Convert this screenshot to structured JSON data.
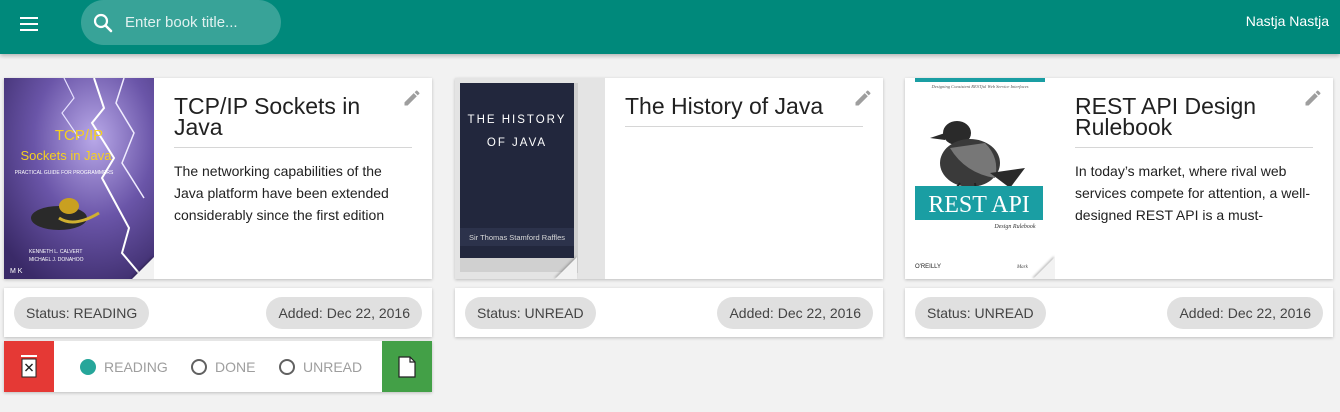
{
  "header": {
    "search_placeholder": "Enter book title...",
    "user_name": "Nastja Nastja",
    "accent_color": "#00897b"
  },
  "books": [
    {
      "title": "TCP/IP Sockets in Java",
      "description": "The networking capabilities of the Java platform have been extended considerably since the first edition",
      "status": "Status: READING",
      "added": "Added: Dec 22, 2016",
      "cover": {
        "title": "TCP/IP Sockets in Java",
        "subtitle": "PRACTICAL GUIDE FOR PROGRAMMERS",
        "authors": [
          "KENNETH L. CALVERT",
          "MICHAEL J. DONAHOO"
        ],
        "publisher": "M K"
      }
    },
    {
      "title": "The History of Java",
      "description": "",
      "status": "Status: UNREAD",
      "added": "Added: Dec 22, 2016",
      "cover": {
        "title_line1": "THE HISTORY",
        "title_line2": "OF JAVA",
        "author": "Sir Thomas Stamford Raffles"
      }
    },
    {
      "title": "REST API Design Rulebook",
      "description": "In today’s market, where rival web services compete for attention, a well-designed REST API is a must-",
      "status": "Status: UNREAD",
      "added": "Added: Dec 22, 2016",
      "cover": {
        "tagline": "Designing Consistent RESTful Web Service Interfaces",
        "title": "REST API",
        "subtitle": "Design Rulebook",
        "publisher": "O'REILLY",
        "author": "Mark"
      }
    }
  ],
  "status_options": {
    "reading": "READING",
    "done": "DONE",
    "unread": "UNREAD",
    "selected": "reading"
  },
  "colors": {
    "delete": "#e53935",
    "save": "#43a047",
    "radio_selected": "#26a69a"
  }
}
